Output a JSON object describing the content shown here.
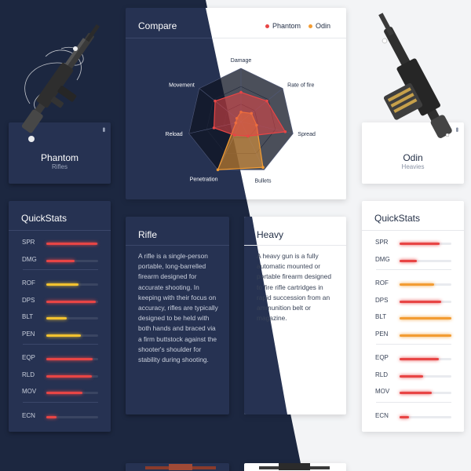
{
  "weapons": {
    "left": {
      "name": "Phantom",
      "class": "Rifles"
    },
    "right": {
      "name": "Odin",
      "class": "Heavies"
    }
  },
  "compare": {
    "title": "Compare",
    "legend": [
      {
        "name": "Phantom",
        "color": "#e84545"
      },
      {
        "name": "Odin",
        "color": "#f39c33"
      }
    ],
    "axes": [
      "Damage",
      "Rate of fire",
      "Spread",
      "Bullets",
      "Penetration",
      "Reload",
      "Movement"
    ],
    "series": [
      {
        "name": "Phantom",
        "color": "#e84545",
        "values": [
          0.55,
          0.62,
          0.85,
          0.3,
          0.28,
          0.52,
          0.62
        ]
      },
      {
        "name": "Odin",
        "color": "#f39c33",
        "values": [
          0.18,
          0.25,
          0.3,
          0.95,
          1.0,
          0.1,
          0.1
        ]
      }
    ]
  },
  "quickstats": {
    "title": "QuickStats",
    "left": {
      "groups": [
        [
          {
            "label": "SPR",
            "value": 0.98,
            "color": "#e84545"
          },
          {
            "label": "DMG",
            "value": 0.55,
            "color": "#e84545"
          }
        ],
        [
          {
            "label": "ROF",
            "value": 0.62,
            "color": "#f2c230"
          },
          {
            "label": "DPS",
            "value": 0.96,
            "color": "#e84545"
          },
          {
            "label": "BLT",
            "value": 0.4,
            "color": "#f2c230"
          },
          {
            "label": "PEN",
            "value": 0.66,
            "color": "#f2c230"
          }
        ],
        [
          {
            "label": "EQP",
            "value": 0.9,
            "color": "#e84545"
          },
          {
            "label": "RLD",
            "value": 0.88,
            "color": "#e84545"
          },
          {
            "label": "MOV",
            "value": 0.7,
            "color": "#e84545"
          }
        ],
        [
          {
            "label": "ECN",
            "value": 0.2,
            "color": "#e84545"
          }
        ]
      ]
    },
    "right": {
      "groups": [
        [
          {
            "label": "SPR",
            "value": 0.78,
            "color": "#e84545"
          },
          {
            "label": "DMG",
            "value": 0.34,
            "color": "#e84545"
          }
        ],
        [
          {
            "label": "ROF",
            "value": 0.66,
            "color": "#f39c33"
          },
          {
            "label": "DPS",
            "value": 0.8,
            "color": "#e84545"
          },
          {
            "label": "BLT",
            "value": 1.0,
            "color": "#f39c33"
          },
          {
            "label": "PEN",
            "value": 1.0,
            "color": "#f39c33"
          }
        ],
        [
          {
            "label": "EQP",
            "value": 0.76,
            "color": "#e84545"
          },
          {
            "label": "RLD",
            "value": 0.46,
            "color": "#e84545"
          },
          {
            "label": "MOV",
            "value": 0.62,
            "color": "#e84545"
          }
        ],
        [
          {
            "label": "ECN",
            "value": 0.18,
            "color": "#e84545"
          }
        ]
      ]
    }
  },
  "descriptions": {
    "rifle": {
      "title": "Rifle",
      "body": "A rifle is a single-person portable, long-barrelled firearm designed for accurate shooting. In keeping with their focus on accuracy, rifles are typically designed to be held with both hands and braced via a firm buttstock against the shooter's shoulder for stability during shooting."
    },
    "heavy": {
      "title": "Heavy",
      "body": "A heavy gun is a fully automatic mounted or portable firearm designed to fire rifle cartridges in rapid succession from an ammunition belt or magazine."
    }
  },
  "icons": {
    "more": "more-vertical-icon"
  }
}
